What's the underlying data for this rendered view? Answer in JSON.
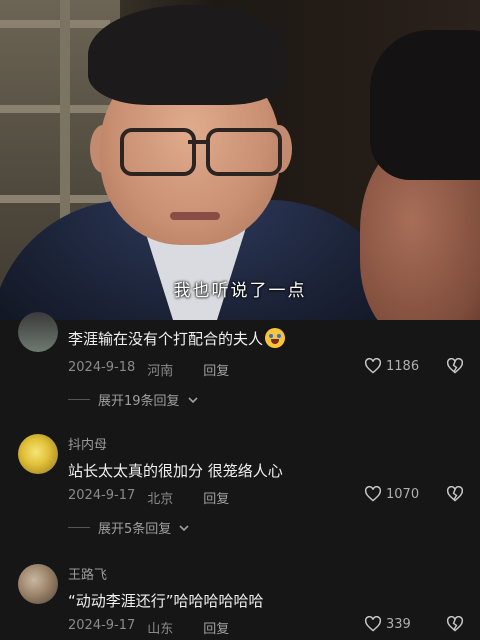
{
  "video": {
    "subtitle": "我也听说了一点"
  },
  "comments": [
    {
      "username": "",
      "text": "李涯输在没有个打配合的夫人",
      "has_emoji": true,
      "date": "2024-9-18",
      "location": "河南",
      "reply_label": "回复",
      "likes": "1186",
      "expand_label": "展开19条回复"
    },
    {
      "username": "抖内母",
      "text": "站长太太真的很加分 很笼络人心",
      "date": "2024-9-17",
      "location": "北京",
      "reply_label": "回复",
      "likes": "1070",
      "expand_label": "展开5条回复"
    },
    {
      "username": "王路飞",
      "text": "“动动李涯还行”哈哈哈哈哈哈",
      "date": "2024-9-17",
      "location": "山东",
      "reply_label": "回复",
      "likes": "339"
    }
  ],
  "icons": {
    "like": "heart-outline-icon",
    "dislike": "broken-heart-icon",
    "expand": "chevron-down-icon"
  },
  "colors": {
    "background": "#161616",
    "text": "#f0f0f0",
    "muted": "#8a8a8a"
  }
}
